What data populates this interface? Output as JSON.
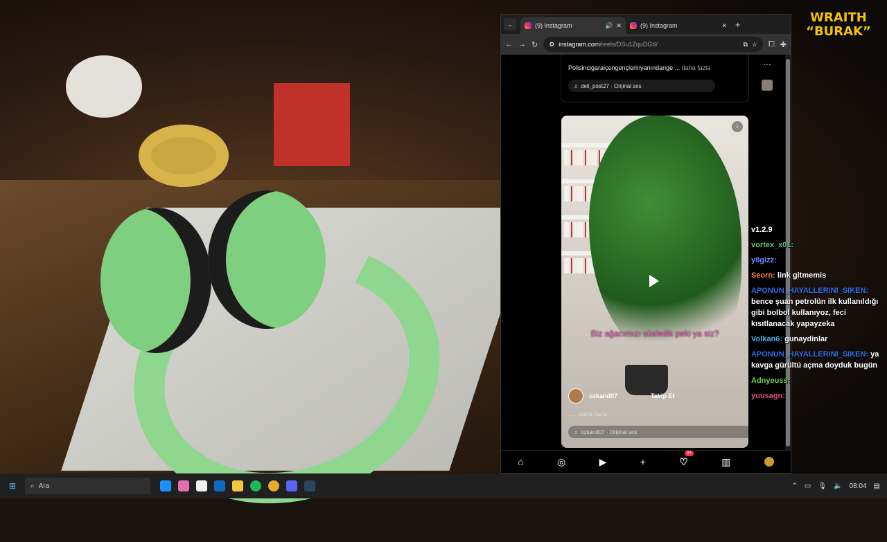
{
  "overlay_brand": {
    "line1": "WRAITH",
    "line2": "“BURAK”"
  },
  "browser": {
    "tabs": [
      {
        "title": "(9) Instagram",
        "active": true
      },
      {
        "title": "(9) Instagram",
        "active": false
      }
    ],
    "url_host": "instagram.com",
    "url_path": "/reels/DSu1ZquDGtI/"
  },
  "instagram": {
    "prev_post": {
      "caption": "Polisincigaraiçengençlerinyanındange ...",
      "more": "daha fazla",
      "audio": "deli_post27 · Orijinal ses"
    },
    "reel": {
      "overlay_text": "Biz ağacımızı süsledik peki ya siz?",
      "author": "ozkand07",
      "follow": "Takip Et",
      "caption_more": ". ... daha fazla",
      "audio": "ozkand07 · Orijinal ses"
    },
    "bottom_nav": {
      "home": "⌂",
      "explore": "◎",
      "reels": "▶",
      "create": "+",
      "activity": "♡",
      "activity_badge": "9+",
      "stats": "▥"
    }
  },
  "chat": {
    "version": "v1.2.9",
    "messages": [
      {
        "user": "vortex_x01:",
        "text": ""
      },
      {
        "user": "y8gizz:",
        "text": ""
      },
      {
        "user": "Seorn:",
        "text": "link gitmemis"
      },
      {
        "user": "APONUN_HAYALLERINI_SIKEN:",
        "text": "bence şuan petrolün ilk kullanıldığı gibi bolbol kullanıyoz, feci kısıtlanacak yapayzeka"
      },
      {
        "user": "Volkan6:",
        "text": "gunaydinlar"
      },
      {
        "user": "APONUN_HAYALLERINI_SIKEN:",
        "text": "ya kavga gürültü açma doyduk bugün"
      },
      {
        "user": "Adnyeuss:",
        "text": ""
      },
      {
        "user": "yuusagn:",
        "text": ""
      }
    ]
  },
  "taskbar": {
    "search_placeholder": "Ara",
    "time": "08:04"
  }
}
